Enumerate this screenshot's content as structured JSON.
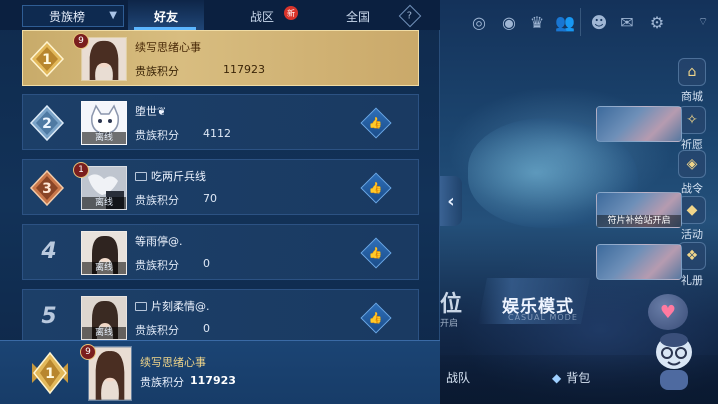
{
  "tabs": {
    "rank_select": "贵族榜",
    "friends": "好友",
    "zone": "战区",
    "zone_badge": "新",
    "national": "全国",
    "help": "?"
  },
  "rows": [
    {
      "rank": "1",
      "level": "9",
      "name": "续写思绪心事",
      "score_label": "贵族积分",
      "score": "117923",
      "offline": "",
      "like": false
    },
    {
      "rank": "2",
      "level": "",
      "name": "堕世❦",
      "score_label": "贵族积分",
      "score": "4112",
      "offline": "离线",
      "like": true
    },
    {
      "rank": "3",
      "level": "1",
      "name": "吃两斤兵线",
      "score_label": "贵族积分",
      "score": "70",
      "offline": "离线",
      "like": true
    },
    {
      "rank": "4",
      "level": "",
      "name": "等雨停@.",
      "score_label": "贵族积分",
      "score": "0",
      "offline": "离线",
      "like": true
    },
    {
      "rank": "5",
      "level": "",
      "name": "片刻柔情@.",
      "score_label": "贵族积分",
      "score": "0",
      "offline": "离线",
      "like": true
    }
  ],
  "me": {
    "rank": "1",
    "level": "9",
    "name": "续写思绪心事",
    "score_label": "贵族积分",
    "score": "117923"
  },
  "side_menu": {
    "shop": "商城",
    "wish": "祈愿",
    "battle_order": "战令",
    "event": "活动",
    "gift": "礼册"
  },
  "banner_text": "符片补给站开启",
  "modes": {
    "ranked_partial": "位",
    "ranked_sub": "开启",
    "entertainment": "娱乐模式",
    "entertainment_sub": "CASUAL MODE"
  },
  "bottom": {
    "team": "战队",
    "bag": "背包"
  },
  "colors": {
    "top_row": "#d8bd80",
    "row_bg": "#1c3f68",
    "accent": "#5cb6ff",
    "new_badge": "#d9342b"
  },
  "icons": [
    "chevron-down-icon",
    "help-icon",
    "thumbs-up-icon",
    "medal-icon",
    "target-icon",
    "replay-icon",
    "trophy-icon",
    "friends-icon",
    "mail-icon",
    "gear-icon",
    "chevron-left-icon",
    "heart-icon",
    "bag-icon"
  ]
}
